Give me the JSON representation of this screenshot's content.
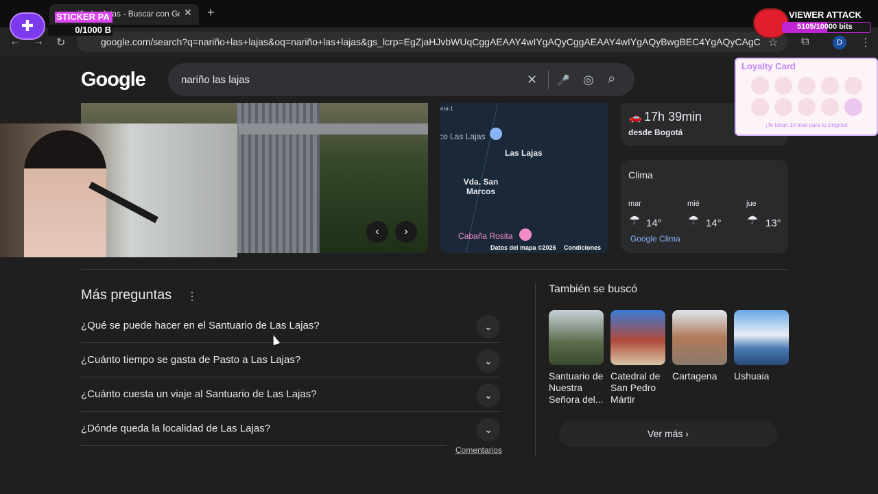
{
  "browser": {
    "tab_title": "nariño las lajas - Buscar con Google",
    "tab_close": "✕",
    "new_tab": "+",
    "url": "google.com/search?q=nariño+las+lajas&oq=nariño+las+lajas&gs_lcrp=EgZjaHJvbWUqCggAEAAY4wIYgAQyCggAEAAY4wIYgAQyBwgBEC4YgAQyCAgCEA...",
    "back_icon": "←",
    "forward_icon": "→",
    "reload_icon": "↻",
    "profile_initial": "D",
    "star_icon": "☆",
    "extension_icon": "⧉",
    "menu_icon": "⋮"
  },
  "google": {
    "logo": "Google",
    "query": "nariño las lajas",
    "clear_icon": "✕",
    "mic_icon": "🎤",
    "lens_icon": "◎",
    "search_icon": "⌕"
  },
  "carousel": {
    "prev": "‹",
    "next": "›"
  },
  "map": {
    "labels": [
      "Las Lajas",
      "Vda. San Marcos",
      "Cabaña Rosita",
      "co Las Lajas",
      "era-1"
    ],
    "footer_data": "Datos del mapa ©2026",
    "footer_terms": "Condiciones"
  },
  "travel": {
    "time": "17h 39min",
    "from": "desde Bogotá",
    "car_icon": "🚗"
  },
  "weather": {
    "title": "Clima",
    "days": [
      {
        "day": "mar",
        "temp": "14°"
      },
      {
        "day": "mié",
        "temp": "14°"
      },
      {
        "day": "jue",
        "temp": "13°"
      }
    ],
    "icon": "☂",
    "link": "Google Clima"
  },
  "paa": {
    "title": "Más preguntas",
    "menu_icon": "⋮",
    "questions": [
      "¿Qué se puede hacer en el Santuario de Las Lajas?",
      "¿Cuánto tiempo se gasta de Pasto a Las Lajas?",
      "¿Cuánto cuesta un viaje al Santuario de Las Lajas?",
      "¿Dónde queda la localidad de Las Lajas?"
    ],
    "chevron": "⌄",
    "comments": "Comentarios"
  },
  "related": {
    "title": "También se buscó",
    "items": [
      {
        "name": "Santuario de Nuestra Señora del...",
        "color": "#5b6b4a"
      },
      {
        "name": "Catedral de San Pedro Mártir",
        "color": "#b04a3a"
      },
      {
        "name": "Cartagena",
        "color": "#8a7a6a"
      },
      {
        "name": "Ushuaia",
        "color": "#4a7ab5"
      }
    ],
    "more": "Ver más ›"
  },
  "overlay": {
    "sticker_label": "STICKER PA",
    "sticker_count": "0/1000 B",
    "viewer_title": "VIEWER ATTACK",
    "viewer_bits": "5105/10000 bits",
    "viewer_progress": 0.5105,
    "loyalty_title": "Loyalty Card",
    "loyalty_note": "¡Te faltan 10 mas para tu zingcita!"
  }
}
